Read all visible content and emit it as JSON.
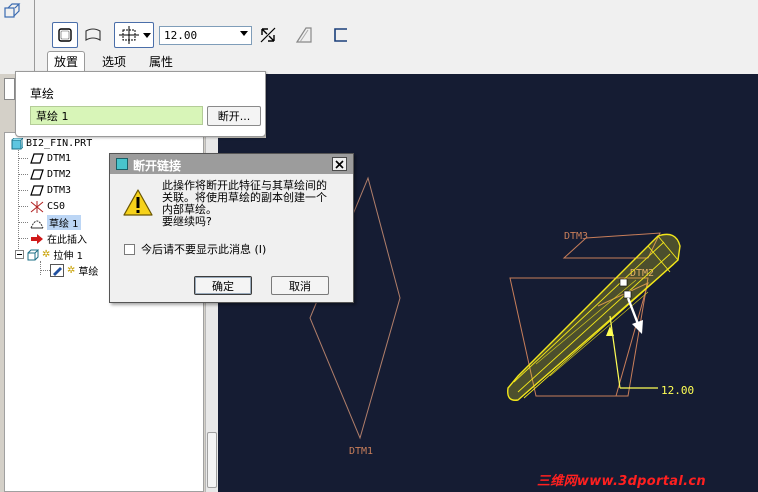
{
  "toolbar": {
    "depth_value": "12.00",
    "tabs": [
      {
        "label": "放置"
      },
      {
        "label": "选项"
      },
      {
        "label": "属性"
      }
    ]
  },
  "placement_panel": {
    "label": "草绘",
    "sketch_value": "草绘 1",
    "break_button": "断开..."
  },
  "model_tree": {
    "root": "BI2_FIN.PRT",
    "items": [
      {
        "label": "DTM1"
      },
      {
        "label": "DTM2"
      },
      {
        "label": "DTM3"
      },
      {
        "label": "CS0"
      },
      {
        "label": "草绘 1"
      },
      {
        "label": "在此插入"
      },
      {
        "label": "拉伸 1"
      },
      {
        "label": "草绘"
      }
    ]
  },
  "dialog": {
    "title": "断开链接",
    "message_lines": [
      "此操作将断开此特征与其草绘间的",
      "关联。将使用草绘的副本创建一个",
      "内部草绘。",
      "要继续吗?"
    ],
    "checkbox_label": "今后请不要显示此消息 (I)",
    "ok_label": "确定",
    "cancel_label": "取消"
  },
  "viewport": {
    "datum_dtm3": "DTM3",
    "datum_dtm2": "DTM2",
    "datum_dtm1": "DTM1",
    "dimension": "12.00",
    "colors": {
      "background": "#151c33",
      "feature": "#f2e61a",
      "datum": "#c87e5a",
      "dimension": "#ffff55"
    }
  },
  "watermark": "三维网www.3dportal.cn"
}
